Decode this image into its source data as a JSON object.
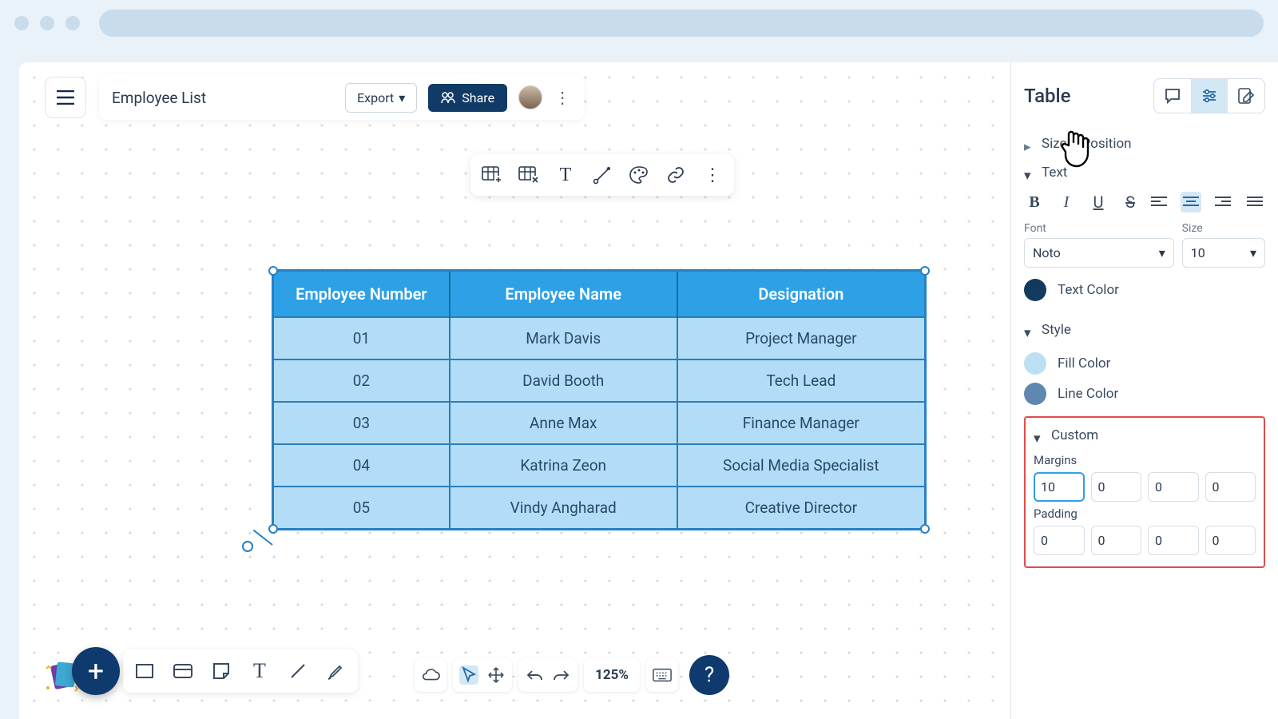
{
  "doc": {
    "title": "Employee List"
  },
  "topbar": {
    "export_label": "Export",
    "share_label": "Share"
  },
  "table": {
    "headers": [
      "Employee Number",
      "Employee Name",
      "Designation"
    ],
    "rows": [
      {
        "num": "01",
        "name": "Mark Davis",
        "des": "Project Manager"
      },
      {
        "num": "02",
        "name": "David Booth",
        "des": "Tech Lead"
      },
      {
        "num": "03",
        "name": "Anne Max",
        "des": "Finance Manager"
      },
      {
        "num": "04",
        "name": "Katrina Zeon",
        "des": "Social Media Specialist"
      },
      {
        "num": "05",
        "name": "Vindy Angharad",
        "des": "Creative Director"
      }
    ]
  },
  "zoom": {
    "level": "125%"
  },
  "sidebar": {
    "title": "Table",
    "sections": {
      "size_position": "Size & Position",
      "text": "Text",
      "style": "Style",
      "custom": "Custom"
    },
    "font_label": "Font",
    "size_label": "Size",
    "font_value": "Noto",
    "size_value": "10",
    "text_color_label": "Text Color",
    "fill_color_label": "Fill Color",
    "line_color_label": "Line Color",
    "margins_label": "Margins",
    "padding_label": "Padding",
    "margins": [
      "10",
      "0",
      "0",
      "0"
    ],
    "padding": [
      "0",
      "0",
      "0",
      "0"
    ],
    "colors": {
      "text": "#123a5e",
      "fill": "#bcdff4",
      "line": "#5f88b0"
    }
  }
}
